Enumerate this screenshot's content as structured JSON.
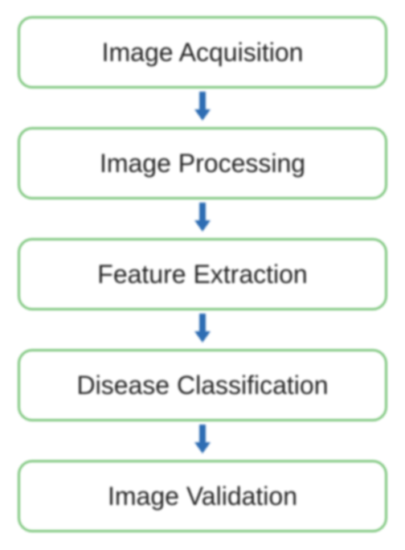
{
  "diagram": {
    "boxes": [
      {
        "label": "Image Acquisition"
      },
      {
        "label": "Image Processing"
      },
      {
        "label": "Feature Extraction"
      },
      {
        "label": "Disease Classification"
      },
      {
        "label": "Image Validation"
      }
    ]
  },
  "chart_data": {
    "type": "flowchart",
    "title": "",
    "nodes": [
      {
        "id": "n1",
        "label": "Image Acquisition"
      },
      {
        "id": "n2",
        "label": "Image Processing"
      },
      {
        "id": "n3",
        "label": "Feature Extraction"
      },
      {
        "id": "n4",
        "label": "Disease Classification"
      },
      {
        "id": "n5",
        "label": "Image Validation"
      }
    ],
    "edges": [
      {
        "from": "n1",
        "to": "n2"
      },
      {
        "from": "n2",
        "to": "n3"
      },
      {
        "from": "n3",
        "to": "n4"
      },
      {
        "from": "n4",
        "to": "n5"
      }
    ],
    "direction": "top-to-bottom",
    "box_border_color": "#7fc77f",
    "arrow_color": "#2e6db3"
  }
}
